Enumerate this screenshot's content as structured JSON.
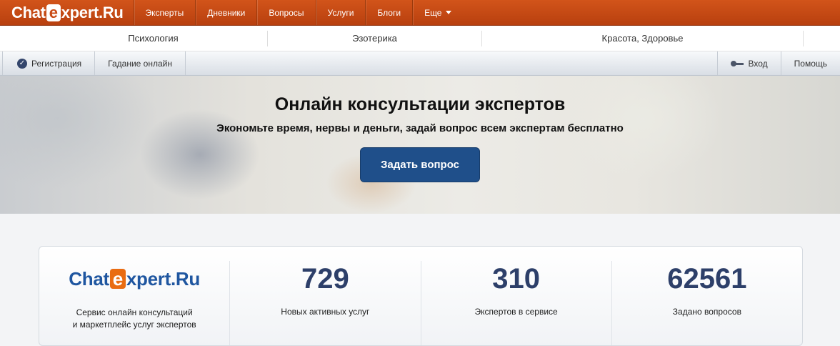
{
  "logo": {
    "prefix": "Chat",
    "e": "e",
    "suffix": "xpert.Ru"
  },
  "nav": [
    "Эксперты",
    "Дневники",
    "Вопросы",
    "Услуги",
    "Блоги"
  ],
  "nav_more": "Еще",
  "categories": [
    "Психология",
    "Эзотерика",
    "Красота, Здоровье"
  ],
  "toolbar": {
    "register": "Регистрация",
    "fortune": "Гадание онлайн",
    "login": "Вход",
    "help": "Помощь"
  },
  "hero": {
    "title": "Онлайн консультации экспертов",
    "subtitle": "Экономьте время, нервы и деньги, задай вопрос всем экспертам бесплатно",
    "button": "Задать вопрос"
  },
  "stats": {
    "brand_prefix": "Chat",
    "brand_e": "e",
    "brand_suffix": "xpert.Ru",
    "brand_line1": "Сервис онлайн консультаций",
    "brand_line2": "и маркетплейс услуг экспертов",
    "items": [
      {
        "value": "729",
        "label": "Новых активных услуг"
      },
      {
        "value": "310",
        "label": "Экспертов в сервисе"
      },
      {
        "value": "62561",
        "label": "Задано вопросов"
      }
    ]
  }
}
